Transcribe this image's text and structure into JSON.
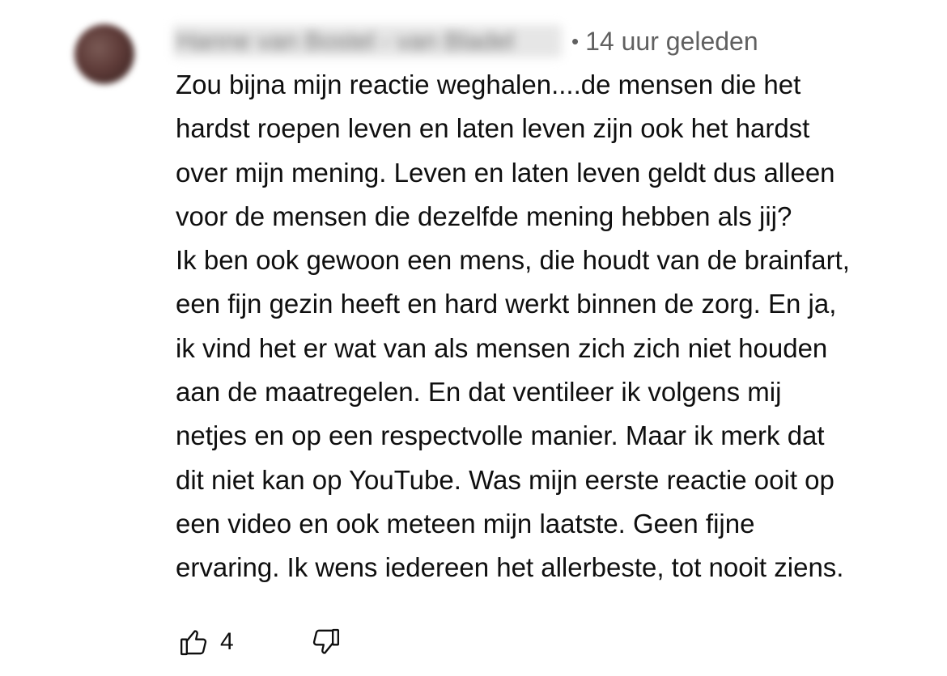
{
  "comment": {
    "author": "Hanne van Bostel - van Bladel",
    "separator": "•",
    "timestamp": "14 uur geleden",
    "lines": [
      "Zou bijna mijn reactie weghalen....de mensen die het",
      "hardst roepen leven en laten leven zijn ook het hardst",
      "over mijn mening. Leven en laten leven geldt dus alleen",
      "voor de mensen die dezelfde mening hebben als jij?",
      "Ik ben ook gewoon een mens, die houdt van de brainfart,",
      "een fijn gezin heeft en hard werkt binnen de zorg. En ja,",
      "ik vind het er wat van als mensen zich zich niet houden",
      "aan de maatregelen. En dat ventileer ik volgens mij",
      "netjes en op een respectvolle manier. Maar ik merk dat",
      "dit niet kan op YouTube. Was mijn eerste reactie ooit op",
      "een video en ook meteen mijn laatste. Geen fijne",
      "ervaring. Ik wens iedereen het allerbeste, tot nooit ziens."
    ],
    "like_count": "4",
    "icons": {
      "like": "thumbs-up-icon",
      "dislike": "thumbs-down-icon"
    }
  }
}
